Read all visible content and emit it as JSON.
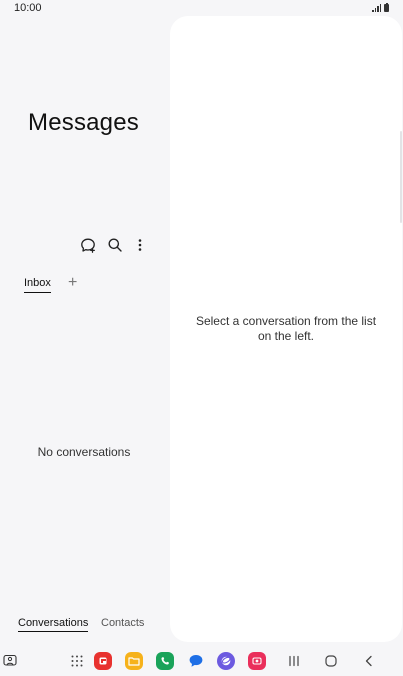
{
  "status_bar": {
    "time": "10:00"
  },
  "left_pane": {
    "title": "Messages",
    "toolbar": {
      "compose_icon": "new-chat-icon",
      "search_icon": "search-icon",
      "more_icon": "more-options-icon"
    },
    "tabs": [
      {
        "label": "Inbox",
        "selected": true
      }
    ],
    "add_tab_label": "+",
    "empty_text": "No conversations",
    "bottom_tabs": [
      {
        "label": "Conversations",
        "selected": true
      },
      {
        "label": "Contacts",
        "selected": false
      }
    ]
  },
  "right_pane": {
    "hint": "Select a conversation from the list on the left."
  },
  "taskbar": {
    "apps": [
      {
        "name": "flipboard-app",
        "color": "#e8322f"
      },
      {
        "name": "my-files-app",
        "color": "#f6b21b"
      },
      {
        "name": "phone-app",
        "color": "#1aa35a"
      },
      {
        "name": "messages-app",
        "color": "#1e6fe6"
      },
      {
        "name": "internet-app",
        "color": "#6c5ae0"
      },
      {
        "name": "screen-recorder-app",
        "color": "#ea2f5b"
      }
    ]
  }
}
